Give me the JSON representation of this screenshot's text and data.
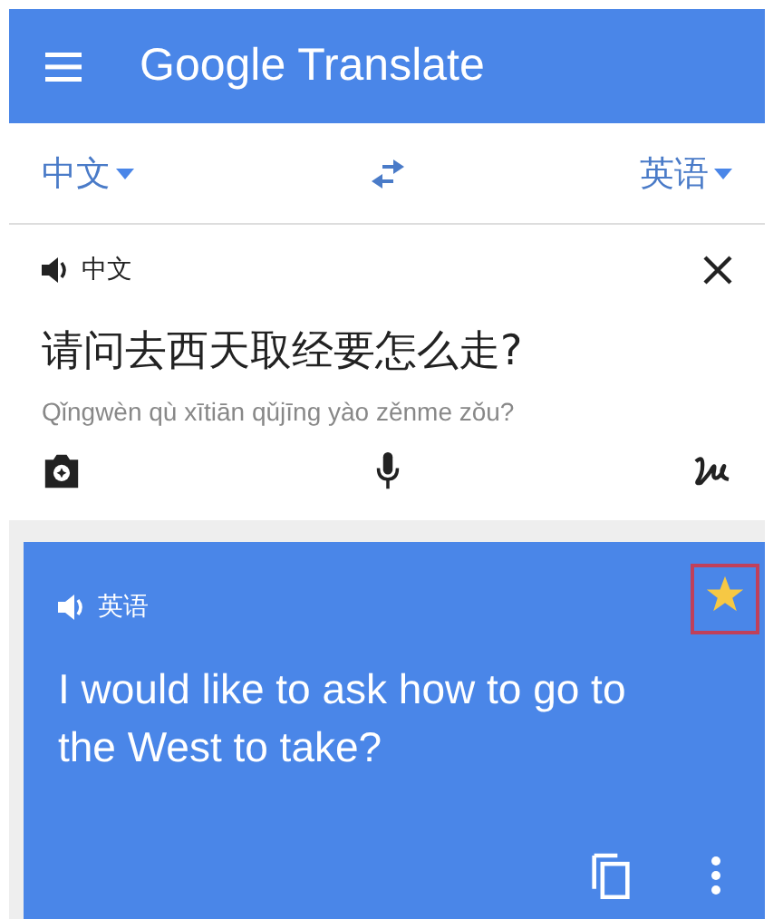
{
  "app_bar": {
    "title": "Google Translate"
  },
  "languages": {
    "source": "中文",
    "target": "英语"
  },
  "input": {
    "language": "中文",
    "text": "请问去西天取经要怎么走?",
    "romanization": "Qǐngwèn qù xītiān qǔjīng yào zěnme zǒu?"
  },
  "output": {
    "language": "英语",
    "text": "I would like to ask how to go to the West to take?",
    "starred": true,
    "highlighted": true
  }
}
